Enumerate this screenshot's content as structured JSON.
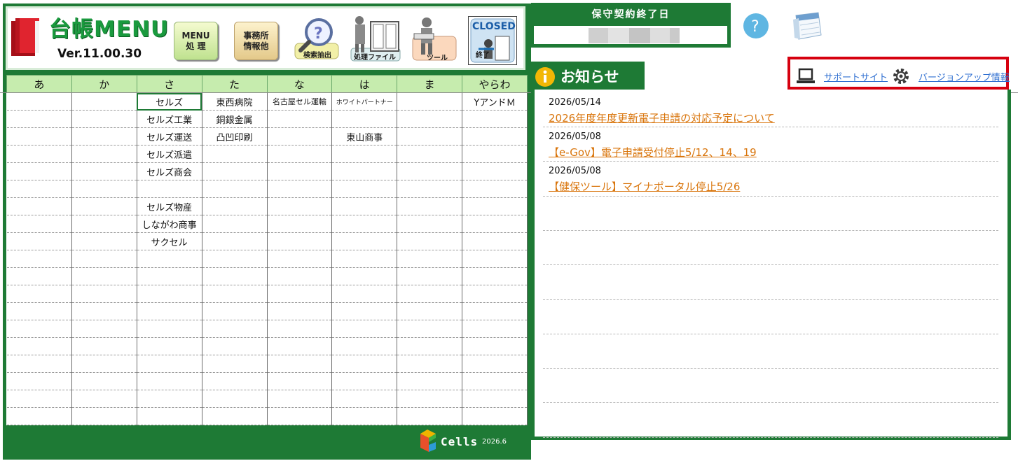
{
  "header": {
    "title": "台帳MENU",
    "version": "Ver.11.00.30",
    "buttons": {
      "menu": "MENU\n処 理",
      "office": "事務所\n情報他",
      "search": "検索抽出",
      "file": "処理ファイル",
      "tool": "ツール",
      "closed": "CLOSED",
      "exit": "終了"
    }
  },
  "grid": {
    "columns": [
      "あ",
      "か",
      "さ",
      "た",
      "な",
      "は",
      "ま",
      "やらわ"
    ],
    "rows": [
      [
        "",
        "",
        "セルズ",
        "東西病院",
        "名古屋セル運輸",
        "ホワイトパートナー",
        "",
        "YアンドＭ"
      ],
      [
        "",
        "",
        "セルズ工業",
        "銅銀金属",
        "",
        "",
        "",
        ""
      ],
      [
        "",
        "",
        "セルズ運送",
        "凸凹印刷",
        "",
        "東山商事",
        "",
        ""
      ],
      [
        "",
        "",
        "セルズ派遣",
        "",
        "",
        "",
        "",
        ""
      ],
      [
        "",
        "",
        "セルズ商会",
        "",
        "",
        "",
        "",
        ""
      ],
      [
        "",
        "",
        "",
        "",
        "",
        "",
        "",
        ""
      ],
      [
        "",
        "",
        "セルズ物産",
        "",
        "",
        "",
        "",
        ""
      ],
      [
        "",
        "",
        "しながわ商事",
        "",
        "",
        "",
        "",
        ""
      ],
      [
        "",
        "",
        "サクセル",
        "",
        "",
        "",
        "",
        ""
      ],
      [
        "",
        "",
        "",
        "",
        "",
        "",
        "",
        ""
      ],
      [
        "",
        "",
        "",
        "",
        "",
        "",
        "",
        ""
      ],
      [
        "",
        "",
        "",
        "",
        "",
        "",
        "",
        ""
      ],
      [
        "",
        "",
        "",
        "",
        "",
        "",
        "",
        ""
      ],
      [
        "",
        "",
        "",
        "",
        "",
        "",
        "",
        ""
      ],
      [
        "",
        "",
        "",
        "",
        "",
        "",
        "",
        ""
      ],
      [
        "",
        "",
        "",
        "",
        "",
        "",
        "",
        ""
      ],
      [
        "",
        "",
        "",
        "",
        "",
        "",
        "",
        ""
      ],
      [
        "",
        "",
        "",
        "",
        "",
        "",
        "",
        ""
      ],
      [
        "",
        "",
        "",
        "",
        "",
        "",
        "",
        ""
      ]
    ]
  },
  "footer": {
    "logo_text": "Cells",
    "year": "2026.6"
  },
  "contract": {
    "label": "保守契約終了日"
  },
  "notice": {
    "title": "お知らせ",
    "support_link": "サポートサイト",
    "update_link": "バージョンアップ情報",
    "items": [
      {
        "date": "2026/05/14",
        "text": "2026年度年度更新電子申請の対応予定について"
      },
      {
        "date": "2026/05/08",
        "text": "【e-Gov】電子申請受付停止5/12、14、19"
      },
      {
        "date": "2026/05/08",
        "text": "【健保ツール】マイナポータル停止5/26"
      }
    ]
  },
  "colors": {
    "brand_green": "#1e7a35",
    "header_green": "#c6ecae",
    "link_blue": "#2f6fd1",
    "news_orange": "#d9750c",
    "highlight_red": "#d6000f"
  },
  "icons": [
    "book-icon",
    "magnifier-icon",
    "file-icon",
    "tool-icon",
    "exit-icon",
    "help-icon",
    "calendar-icon",
    "info-icon",
    "laptop-icon",
    "gear-icon",
    "cells-logo-icon"
  ]
}
